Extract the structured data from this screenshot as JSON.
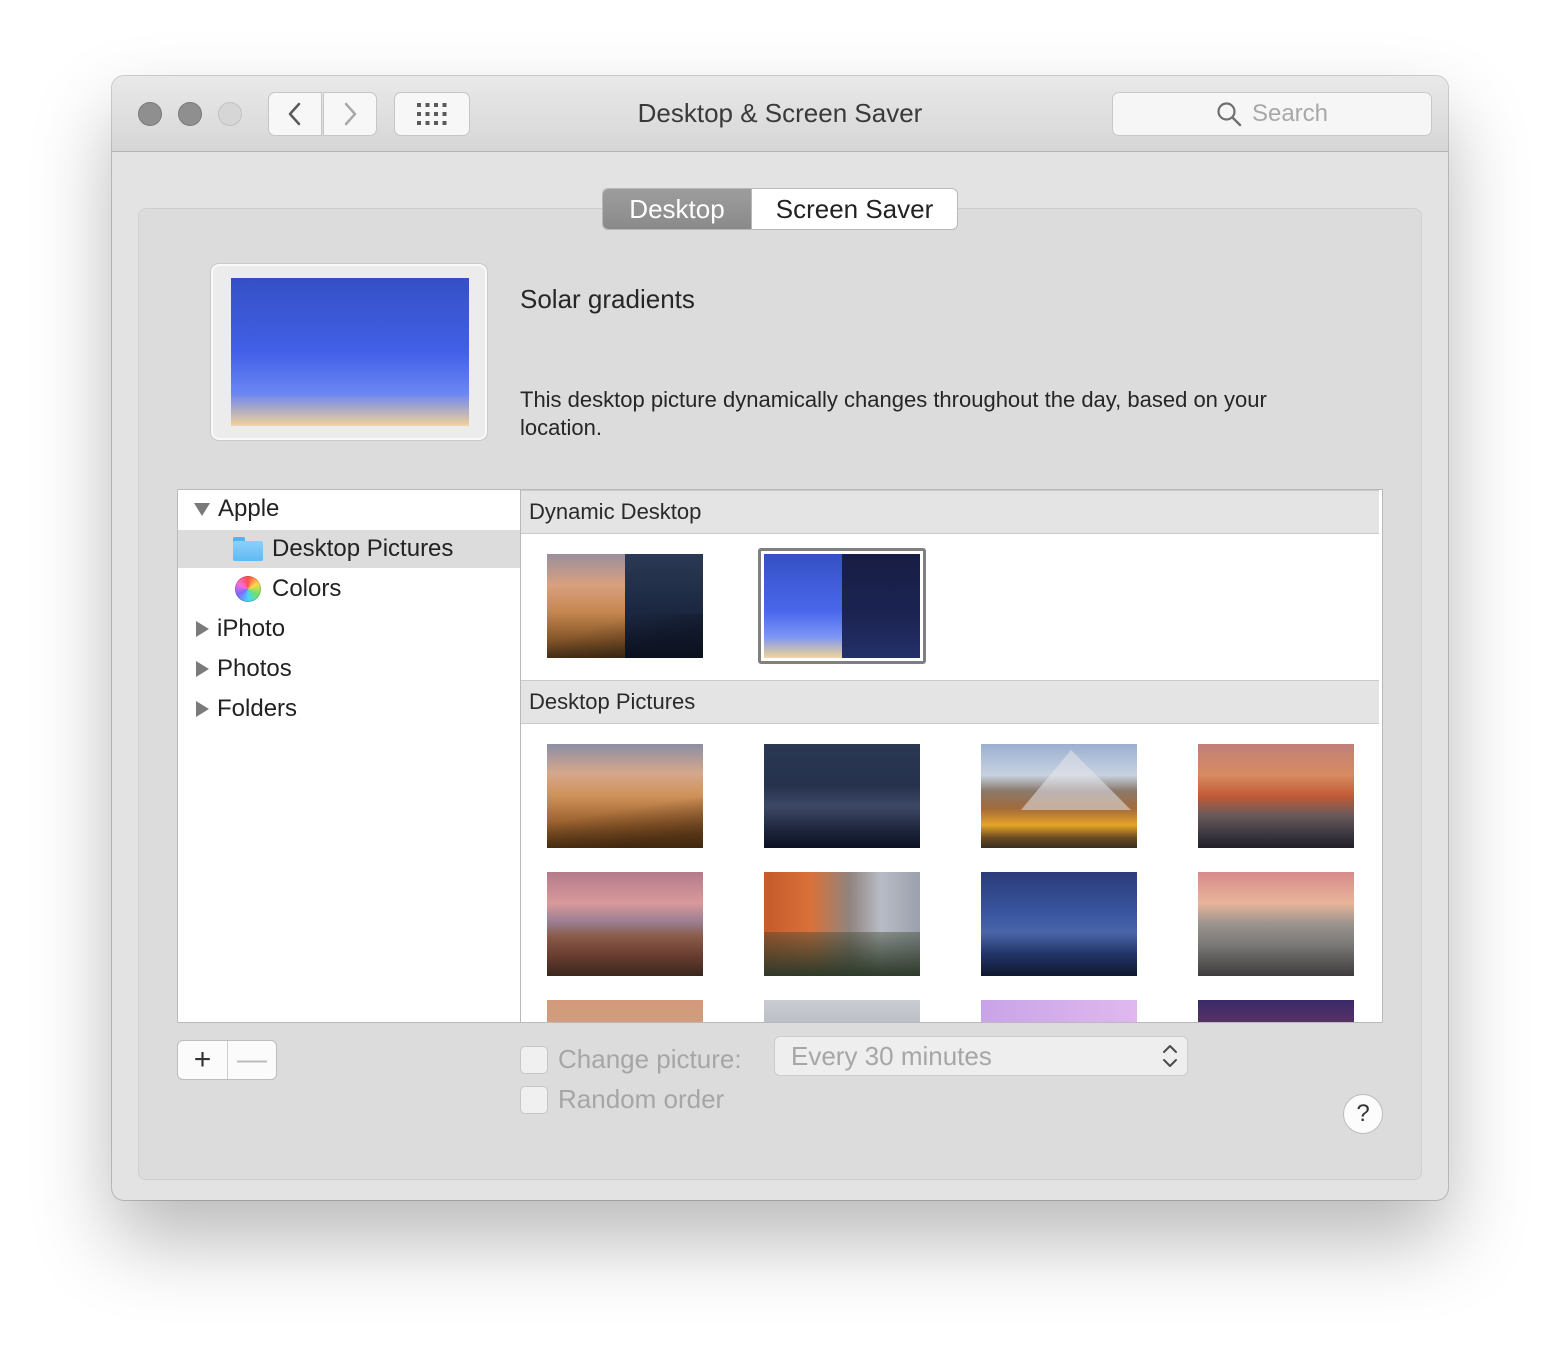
{
  "window": {
    "title": "Desktop & Screen Saver",
    "search_placeholder": "Search"
  },
  "tabs": [
    {
      "label": "Desktop",
      "active": true
    },
    {
      "label": "Screen Saver",
      "active": false
    }
  ],
  "current_picture": {
    "name": "Solar gradients",
    "description": "This desktop picture dynamically changes throughout the day, based on your location."
  },
  "sidebar": {
    "items": [
      {
        "label": "Apple",
        "icon": "disclosure-triangle-expanded",
        "expanded": true
      },
      {
        "label": "Desktop Pictures",
        "icon": "folder-icon",
        "selected": true
      },
      {
        "label": "Colors",
        "icon": "color-wheel-icon"
      },
      {
        "label": "iPhoto",
        "icon": "disclosure-triangle-collapsed"
      },
      {
        "label": "Photos",
        "icon": "disclosure-triangle-collapsed"
      },
      {
        "label": "Folders",
        "icon": "disclosure-triangle-collapsed"
      }
    ]
  },
  "sections": [
    {
      "title": "Dynamic Desktop",
      "thumbnails": [
        "mojave-dynamic",
        "solar-gradients"
      ],
      "selected": "solar-gradients"
    },
    {
      "title": "Desktop Pictures",
      "thumbnails": [
        "mojave-day",
        "mojave-night",
        "high-sierra",
        "sierra",
        "sierra-2",
        "el-capitan",
        "yosemite-night",
        "yosemite",
        "yosemite-2",
        "el-capitan-2",
        "purple-gradient",
        "sunset-streaks"
      ]
    }
  ],
  "controls": {
    "add_label": "+",
    "remove_label": "—",
    "change_picture_label": "Change picture:",
    "change_picture_checked": false,
    "interval_value": "Every 30 minutes",
    "random_order_label": "Random order",
    "random_order_checked": false,
    "help_label": "?"
  }
}
